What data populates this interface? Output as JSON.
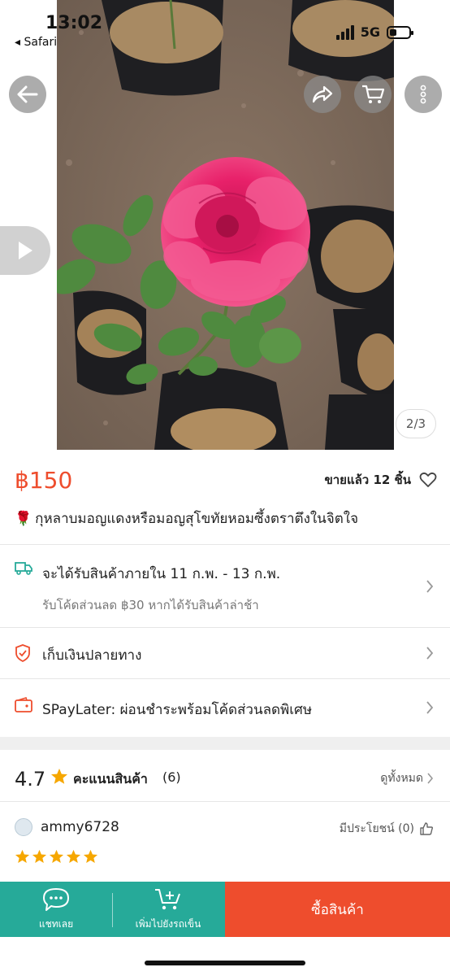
{
  "status_bar": {
    "time": "13:02",
    "back_app": "◂ Safari",
    "network": "5G"
  },
  "gallery": {
    "counter": "2/3"
  },
  "product": {
    "price": "฿150",
    "sold_text": "ขายแล้ว 12 ชิ้น",
    "title_emoji": "🌹",
    "title": "กุหลาบมอญแดงหรือมอญสุโขทัยหอมซึ้งตราตึงในจิตใจ"
  },
  "shipping": {
    "text": "จะได้รับสินค้าภายใน 11 ก.พ. - 13 ก.พ.",
    "sub": "รับโค้ดส่วนลด ฿30 หากได้รับสินค้าล่าช้า"
  },
  "cod": {
    "text": "เก็บเงินปลายทาง"
  },
  "paylater": {
    "text": "SPayLater: ผ่อนชำระพร้อมโค้ดส่วนลดพิเศษ"
  },
  "rating": {
    "score": "4.7",
    "label": "คะแนนสินค้า",
    "count": "(6)",
    "see_all": "ดูทั้งหมด"
  },
  "review": {
    "username": "ammy6728",
    "helpful": "มีประโยชน์ (0)",
    "stars": 5
  },
  "bottom_bar": {
    "chat_label": "แชทเลย",
    "cart_label": "เพิ่มไปยังรถเข็น",
    "buy_label": "ซื้อสินค้า"
  },
  "colors": {
    "accent": "#ee4d2d",
    "teal": "#26aa99",
    "star": "#f6a700"
  },
  "icons": [
    "back-arrow-icon",
    "share-icon",
    "cart-icon",
    "more-icon",
    "play-icon",
    "heart-icon",
    "truck-icon",
    "shield-icon",
    "wallet-icon",
    "chevron-right-icon",
    "star-icon",
    "thumbs-up-icon",
    "chat-icon",
    "add-cart-icon"
  ]
}
